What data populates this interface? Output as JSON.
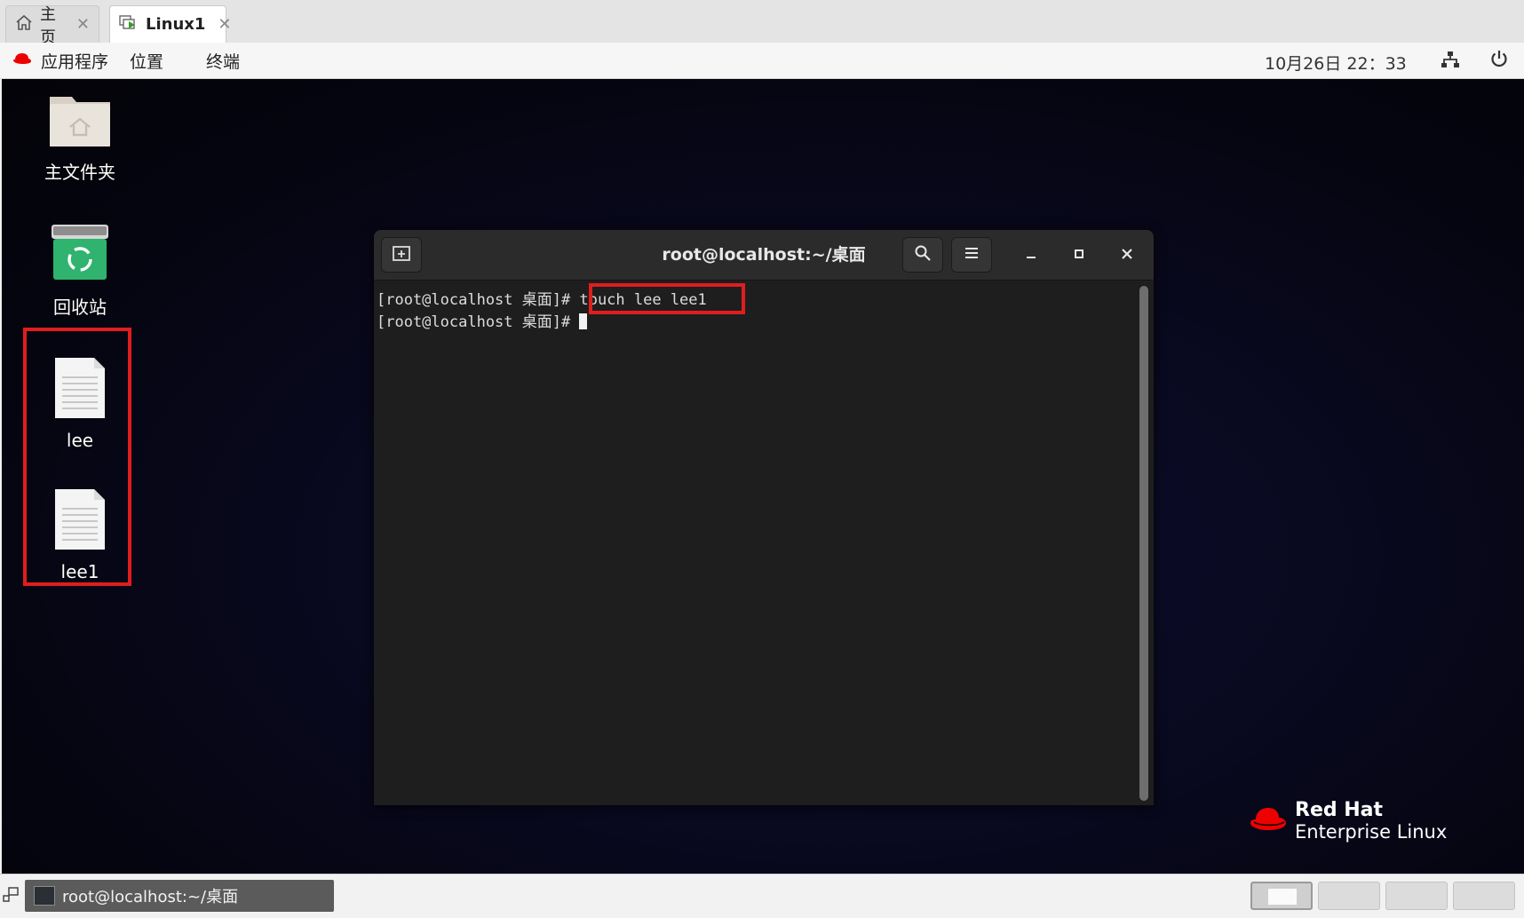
{
  "tabs": [
    {
      "label": "主页",
      "icon": "home-icon"
    },
    {
      "label": "Linux1",
      "icon": "vm-icon"
    }
  ],
  "topbar": {
    "menu": [
      "应用程序",
      "位置",
      "终端"
    ],
    "clock": "10月26日 22：33"
  },
  "desktop": {
    "icons": [
      {
        "label": "主文件夹",
        "icon": "home-folder-icon"
      },
      {
        "label": "回收站",
        "icon": "trash-icon"
      },
      {
        "label": "lee",
        "icon": "file-icon"
      },
      {
        "label": "lee1",
        "icon": "file-icon"
      }
    ],
    "branding": {
      "line1": "Red Hat",
      "line2": "Enterprise Linux"
    }
  },
  "terminal": {
    "title": "root@localhost:~/桌面",
    "lines": [
      {
        "prompt": "[root@localhost 桌面]# ",
        "command": "touch lee lee1"
      },
      {
        "prompt": "[root@localhost 桌面]# ",
        "command": ""
      }
    ]
  },
  "taskbar": {
    "window_label": "root@localhost:~/桌面",
    "workspaces": 4,
    "active_workspace": 1
  },
  "colors": {
    "highlight": "#e11d1d",
    "terminal_bg": "#1e1e1e",
    "redhat_red": "#ee0000"
  }
}
